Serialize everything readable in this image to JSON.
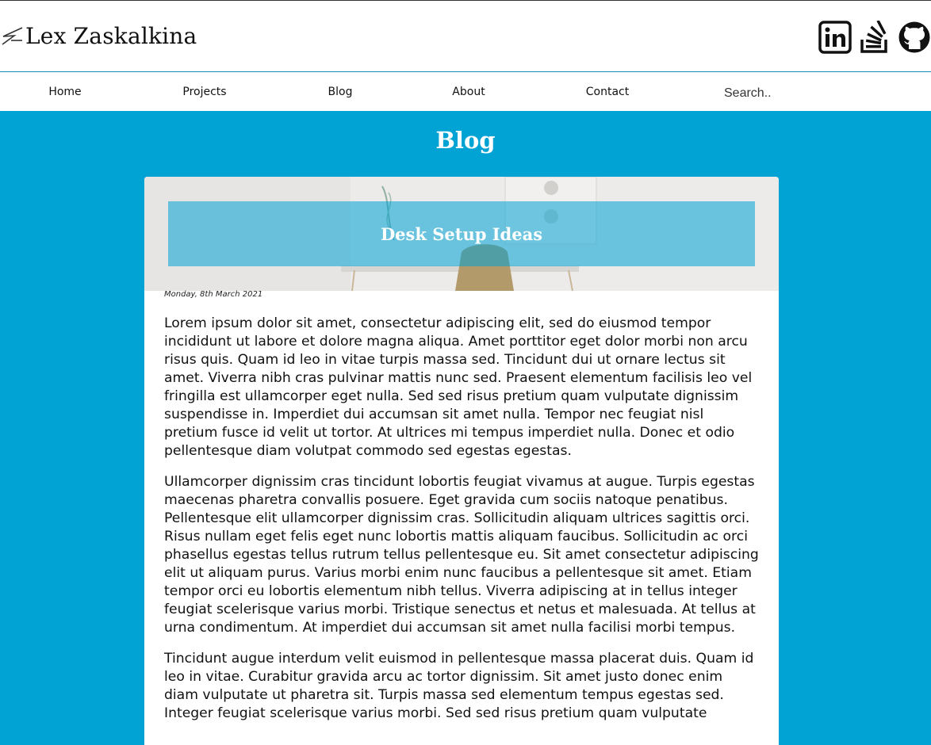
{
  "header": {
    "brand_name": "Lex Zaskalkina",
    "socials": [
      {
        "icon": "linkedin-icon"
      },
      {
        "icon": "stackoverflow-icon"
      },
      {
        "icon": "github-icon"
      }
    ]
  },
  "nav": {
    "items": [
      {
        "label": "Home"
      },
      {
        "label": "Projects"
      },
      {
        "label": "Blog"
      },
      {
        "label": "About"
      },
      {
        "label": "Contact"
      }
    ],
    "search_placeholder": "Search.."
  },
  "page": {
    "title": "Blog"
  },
  "post": {
    "title": "Desk Setup Ideas",
    "date": "Monday, 8th March 2021",
    "paragraphs": [
      "Lorem ipsum dolor sit amet, consectetur adipiscing elit, sed do eiusmod tempor incididunt ut labore et dolore magna aliqua. Amet porttitor eget dolor morbi non arcu risus quis. Quam id leo in vitae turpis massa sed. Tincidunt dui ut ornare lectus sit amet. Viverra nibh cras pulvinar mattis nunc sed. Praesent elementum facilisis leo vel fringilla est ullamcorper eget nulla. Sed sed risus pretium quam vulputate dignissim suspendisse in. Imperdiet dui accumsan sit amet nulla. Tempor nec feugiat nisl pretium fusce id velit ut tortor. At ultrices mi tempus imperdiet nulla. Donec et odio pellentesque diam volutpat commodo sed egestas egestas.",
      "Ullamcorper dignissim cras tincidunt lobortis feugiat vivamus at augue. Turpis egestas maecenas pharetra convallis posuere. Eget gravida cum sociis natoque penatibus. Pellentesque elit ullamcorper dignissim cras. Sollicitudin aliquam ultrices sagittis orci. Risus nullam eget felis eget nunc lobortis mattis aliquam faucibus. Sollicitudin ac orci phasellus egestas tellus rutrum tellus pellentesque eu. Sit amet consectetur adipiscing elit ut aliquam purus. Varius morbi enim nunc faucibus a pellentesque sit amet. Etiam tempor orci eu lobortis elementum nibh tellus. Viverra adipiscing at in tellus integer feugiat scelerisque varius morbi. Tristique senectus et netus et malesuada. At tellus at urna condimentum. At imperdiet dui accumsan sit amet nulla facilisi morbi tempus.",
      "Tincidunt augue interdum velit euismod in pellentesque massa placerat duis. Quam id leo in vitae. Curabitur gravida arcu ac tortor dignissim. Sit amet justo donec enim diam vulputate ut pharetra sit. Turpis massa sed elementum tempus egestas sed. Integer feugiat scelerisque varius morbi. Sed sed risus pretium quam vulputate"
    ]
  },
  "colors": {
    "accent": "#00a3d3",
    "banner": "#5cc3e2"
  }
}
